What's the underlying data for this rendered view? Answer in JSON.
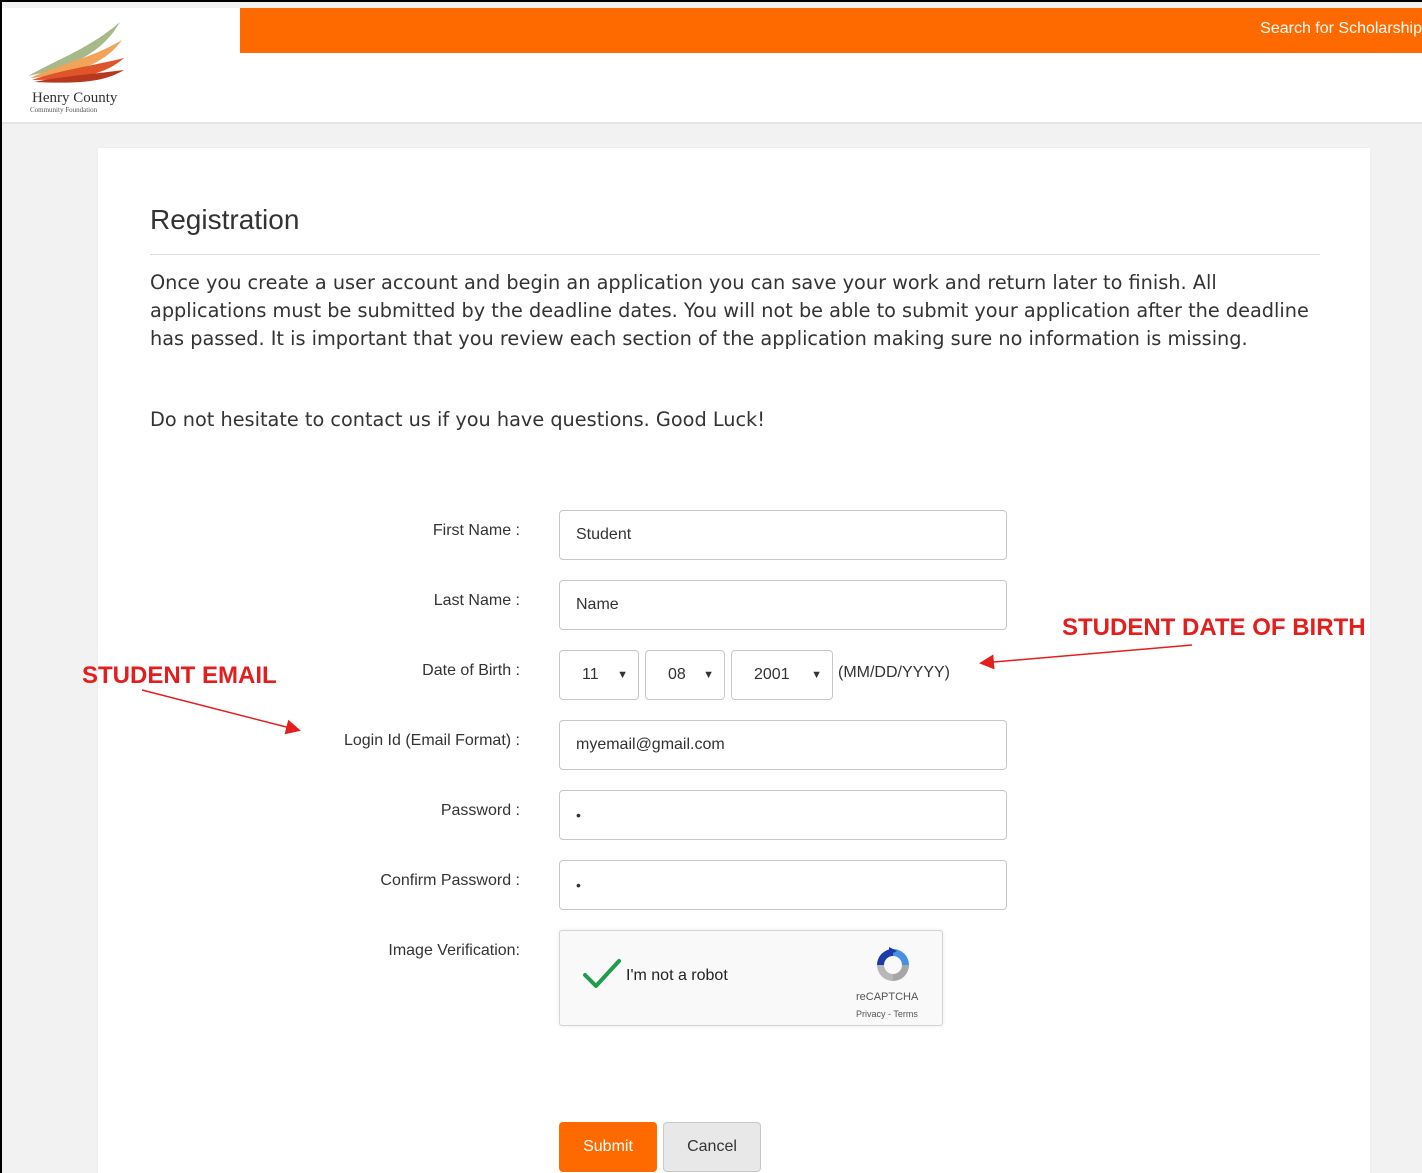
{
  "header": {
    "nav_link": "Search for Scholarship",
    "logo_name": "Henry County",
    "logo_sub": "Community Foundation",
    "brand_color": "#ff6a00"
  },
  "page": {
    "title": "Registration",
    "intro": "Once you create a user account and begin an application you can save your work and return later to finish. All applications must be submitted by the deadline dates. You will not be able to submit your application after the deadline has passed. It is important that you review each section of the application making sure no information is missing.",
    "intro2": "Do not hesitate to contact us if you have questions. Good Luck!"
  },
  "form": {
    "first_name": {
      "label": "First Name :",
      "value": "Student"
    },
    "last_name": {
      "label": "Last Name :",
      "value": "Name"
    },
    "dob": {
      "label": "Date of Birth :",
      "month": "11",
      "day": "08",
      "year": "2001",
      "hint": "(MM/DD/YYYY)",
      "caret": "▼"
    },
    "login": {
      "label": "Login Id (Email Format) :",
      "value": "myemail@gmail.com"
    },
    "password": {
      "label": "Password :",
      "value": "•"
    },
    "confirm_password": {
      "label": "Confirm Password :",
      "value": "•"
    },
    "captcha": {
      "label": "Image Verification:",
      "text": "I'm not a robot",
      "brand": "reCAPTCHA",
      "links": "Privacy - Terms"
    },
    "submit_label": "Submit",
    "cancel_label": "Cancel"
  },
  "annotations": {
    "dob": "STUDENT DATE OF BIRTH",
    "email": "STUDENT EMAIL",
    "color": "#e41d1d"
  }
}
